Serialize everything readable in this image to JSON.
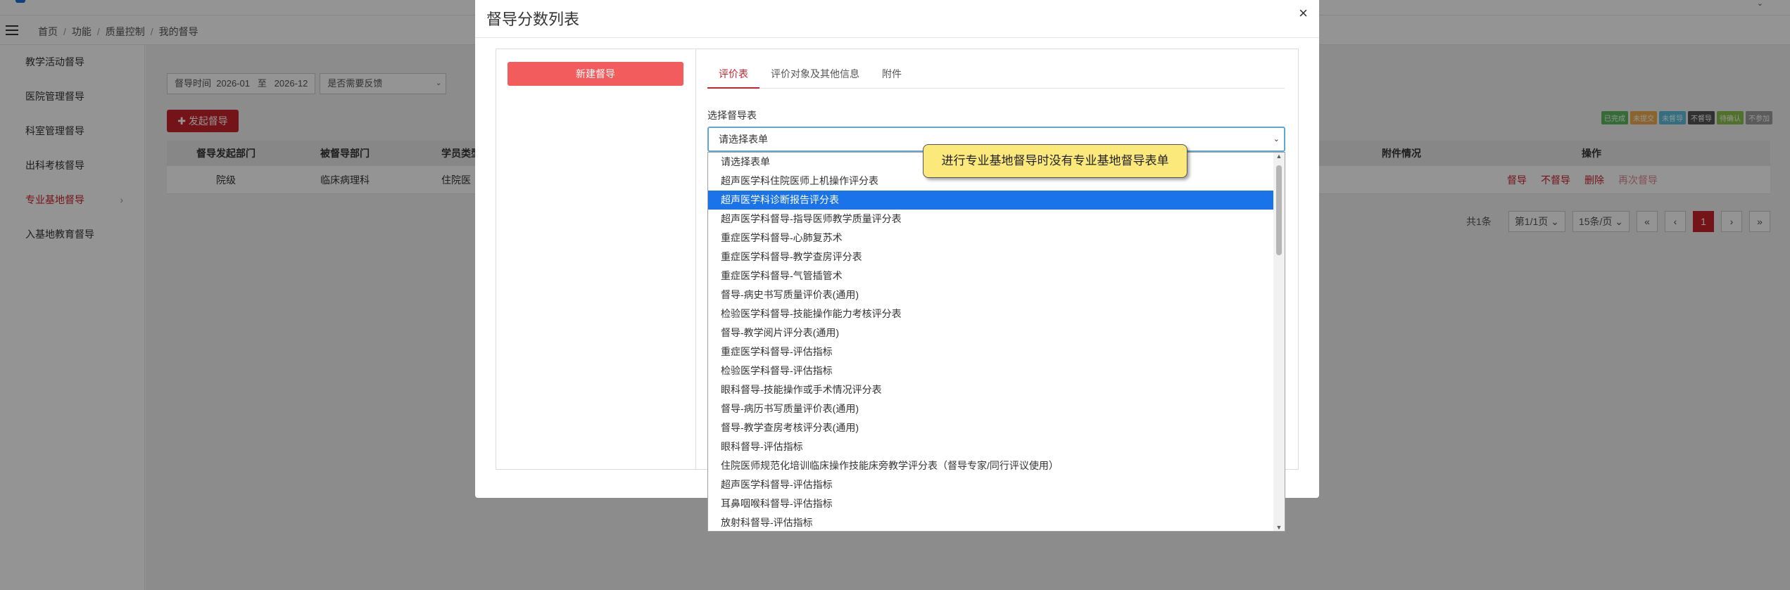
{
  "breadcrumb": [
    "首页",
    "功能",
    "质量控制",
    "我的督导"
  ],
  "sidebar": {
    "items": [
      {
        "label": "教学活动督导"
      },
      {
        "label": "医院管理督导"
      },
      {
        "label": "科室管理督导"
      },
      {
        "label": "出科考核督导"
      },
      {
        "label": "专业基地督导",
        "active": true
      },
      {
        "label": "入基地教育督导"
      }
    ]
  },
  "filters": {
    "time_label": "督导时间",
    "time_from": "2026-01",
    "time_sep": "至",
    "time_to": "2026-12",
    "feedback_select": "是否需要反馈"
  },
  "launch_button": "发起督导",
  "status_badges": [
    {
      "label": "已完成",
      "color": "#5cb85c"
    },
    {
      "label": "未提交",
      "color": "#f0ad4e"
    },
    {
      "label": "未督导",
      "color": "#5bc0de"
    },
    {
      "label": "不督导",
      "color": "#555555"
    },
    {
      "label": "待确认",
      "color": "#8bc34a"
    },
    {
      "label": "不参加",
      "color": "#9e9e9e"
    }
  ],
  "table": {
    "headers": [
      "督导发起部门",
      "被督导部门",
      "学员类型",
      "附件情况",
      "操作"
    ],
    "rows": [
      {
        "dept": "院级",
        "target": "临床病理科",
        "type": "住院医",
        "ops": [
          "督导",
          "不督导",
          "删除",
          "再次督导"
        ]
      }
    ]
  },
  "pager": {
    "total": "共1条",
    "page_select": "第1/1页",
    "size_select": "15条/页",
    "first": "«",
    "prev": "‹",
    "current": "1",
    "next": "›",
    "last": "»"
  },
  "modal": {
    "title": "督导分数列表",
    "close": "×",
    "new_button": "新建督导",
    "tabs": [
      "评价表",
      "评价对象及其他信息",
      "附件"
    ],
    "select_label": "选择督导表",
    "select_value": "请选择表单"
  },
  "dropdown": {
    "selected_index": 2,
    "options": [
      "请选择表单",
      "超声医学科住院医师上机操作评分表",
      "超声医学科诊断报告评分表",
      "超声医学科督导-指导医师教学质量评分表",
      "重症医学科督导-心肺复苏术",
      "重症医学科督导-教学查房评分表",
      "重症医学科督导-气管插管术",
      "督导-病史书写质量评价表(通用)",
      "检验医学科督导-技能操作能力考核评分表",
      "督导-教学阅片评分表(通用)",
      "重症医学科督导-评估指标",
      "检验医学科督导-评估指标",
      "眼科督导-技能操作或手术情况评分表",
      "督导-病历书写质量评价表(通用)",
      "督导-教学查房考核评分表(通用)",
      "眼科督导-评估指标",
      "住院医师规范化培训临床操作技能床旁教学评分表（督导专家/同行评议使用）",
      "超声医学科督导-评估指标",
      "耳鼻咽喉科督导-评估指标",
      "放射科督导-评估指标"
    ]
  },
  "tooltip": "进行专业基地督导时没有专业基地督导表单"
}
